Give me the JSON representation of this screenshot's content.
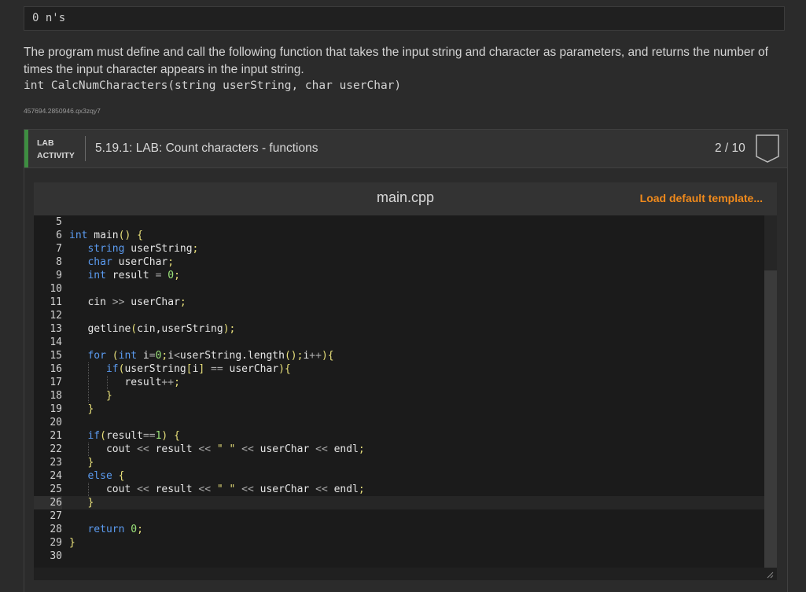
{
  "output": {
    "text": "0 n's"
  },
  "description": {
    "text": "The program must define and call the following function that takes the input string and character as parameters, and returns the number of times the input character appears in the input string.",
    "signature": "int CalcNumCharacters(string userString, char userChar)",
    "id": "457694.2850946.qx3zqy7"
  },
  "lab": {
    "tag_line1": "LAB",
    "tag_line2": "ACTIVITY",
    "title": "5.19.1: LAB: Count characters - functions",
    "score": "2 / 10"
  },
  "editor": {
    "filename": "main.cpp",
    "load_template": "Load default template...",
    "active_line": "26",
    "lines": [
      {
        "n": "5",
        "text": ""
      },
      {
        "n": "6",
        "text": "int main() {"
      },
      {
        "n": "7",
        "text": "   string userString;"
      },
      {
        "n": "8",
        "text": "   char userChar;"
      },
      {
        "n": "9",
        "text": "   int result = 0;"
      },
      {
        "n": "10",
        "text": ""
      },
      {
        "n": "11",
        "text": "   cin >> userChar;"
      },
      {
        "n": "12",
        "text": ""
      },
      {
        "n": "13",
        "text": "   getline(cin,userString);"
      },
      {
        "n": "14",
        "text": ""
      },
      {
        "n": "15",
        "text": "   for (int i=0;i<userString.length();i++){"
      },
      {
        "n": "16",
        "text": "      if(userString[i] == userChar){"
      },
      {
        "n": "17",
        "text": "         result++;"
      },
      {
        "n": "18",
        "text": "      }"
      },
      {
        "n": "19",
        "text": "   }"
      },
      {
        "n": "20",
        "text": ""
      },
      {
        "n": "21",
        "text": "   if(result==1) {"
      },
      {
        "n": "22",
        "text": "      cout << result << \" \" << userChar << endl;"
      },
      {
        "n": "23",
        "text": "   }"
      },
      {
        "n": "24",
        "text": "   else {"
      },
      {
        "n": "25",
        "text": "      cout << result << \" \" << userChar << endl;"
      },
      {
        "n": "26",
        "text": "   }"
      },
      {
        "n": "27",
        "text": ""
      },
      {
        "n": "28",
        "text": "   return 0;"
      },
      {
        "n": "29",
        "text": "}"
      },
      {
        "n": "30",
        "text": ""
      }
    ]
  },
  "colors": {
    "accent_green": "#3e8e41",
    "load_template_orange": "#f08a1c",
    "keyword_blue": "#5b9bf0",
    "number_green": "#9be37a",
    "string_yellow": "#e8e07a"
  }
}
